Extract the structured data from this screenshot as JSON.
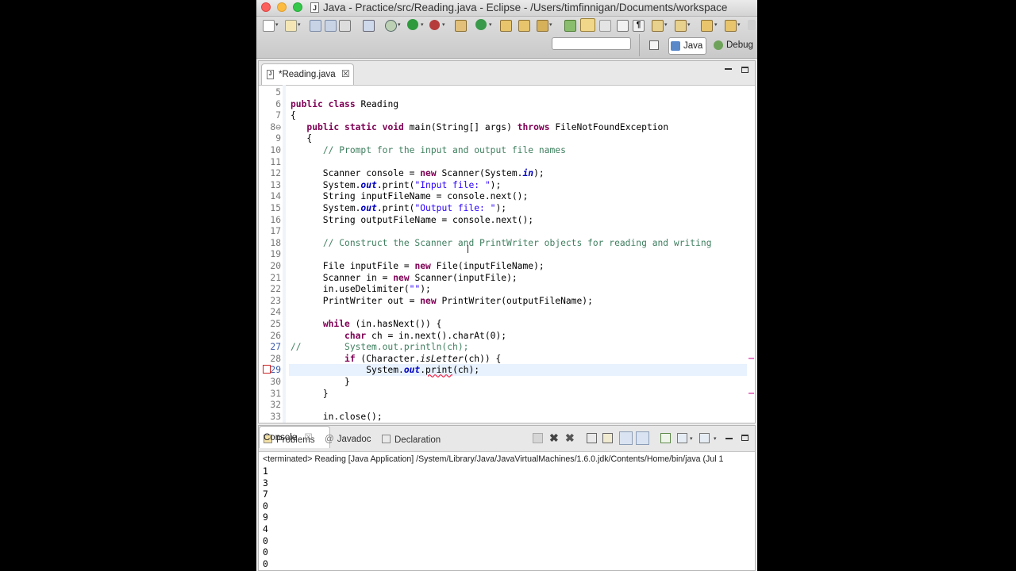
{
  "window": {
    "title": "Java - Practice/src/Reading.java - Eclipse - /Users/timfinnigan/Documents/workspace",
    "title_icon": "J"
  },
  "toolbar": {
    "perspectives": [
      {
        "label": "Java",
        "icon": "java-perspective-icon"
      },
      {
        "label": "Debug",
        "icon": "debug-bug-icon"
      }
    ],
    "search_value": ""
  },
  "editor": {
    "tab": {
      "label": "*Reading.java",
      "close": "☒",
      "icon": "J"
    },
    "lines": [
      {
        "n": "5",
        "code": ""
      },
      {
        "n": "6",
        "code": "public class Reading"
      },
      {
        "n": "7",
        "code": "{"
      },
      {
        "n": "8⊖",
        "code": "   public static void main(String[] args) throws FileNotFoundException"
      },
      {
        "n": "9",
        "code": "   {"
      },
      {
        "n": "10",
        "code": "      // Prompt for the input and output file names"
      },
      {
        "n": "11",
        "code": ""
      },
      {
        "n": "12",
        "code": "      Scanner console = new Scanner(System.in);"
      },
      {
        "n": "13",
        "code": "      System.out.print(\"Input file: \");"
      },
      {
        "n": "14",
        "code": "      String inputFileName = console.next();"
      },
      {
        "n": "15",
        "code": "      System.out.print(\"Output file: \");"
      },
      {
        "n": "16",
        "code": "      String outputFileName = console.next();"
      },
      {
        "n": "17",
        "code": ""
      },
      {
        "n": "18",
        "code": "      // Construct the Scanner and PrintWriter objects for reading and writing"
      },
      {
        "n": "19",
        "code": ""
      },
      {
        "n": "20",
        "code": "      File inputFile = new File(inputFileName);"
      },
      {
        "n": "21",
        "code": "      Scanner in = new Scanner(inputFile);"
      },
      {
        "n": "22",
        "code": "      in.useDelimiter(\"\");"
      },
      {
        "n": "23",
        "code": "      PrintWriter out = new PrintWriter(outputFileName);"
      },
      {
        "n": "24",
        "code": ""
      },
      {
        "n": "25",
        "code": "      while (in.hasNext()) {"
      },
      {
        "n": "26",
        "code": "          char ch = in.next().charAt(0);"
      },
      {
        "n": "27",
        "code": "//        System.out.println(ch);"
      },
      {
        "n": "28",
        "code": "          if (Character.isLetter(ch)) {"
      },
      {
        "n": "29",
        "code": "              System.out.print(ch);"
      },
      {
        "n": "30",
        "code": "          }"
      },
      {
        "n": "31",
        "code": "      }"
      },
      {
        "n": "32",
        "code": ""
      },
      {
        "n": "33",
        "code": "      in.close();"
      }
    ]
  },
  "console_view": {
    "tabs": [
      {
        "label": "Problems",
        "icon": "problems-icon"
      },
      {
        "label": "Javadoc",
        "icon": "at-icon"
      },
      {
        "label": "Declaration",
        "icon": "declaration-icon"
      },
      {
        "label": "Console",
        "icon": "console-icon"
      }
    ],
    "header": "<terminated> Reading [Java Application] /System/Library/Java/JavaVirtualMachines/1.6.0.jdk/Contents/Home/bin/java (Jul 1",
    "output": [
      "1",
      "3",
      "7",
      "0",
      "9",
      "4",
      "0",
      "0",
      "0"
    ]
  },
  "colors": {
    "keyword": "#7f0055",
    "comment": "#3f7f5f",
    "string": "#2a00ff",
    "field": "#0000c0",
    "current_line": "#e8f2fe"
  }
}
